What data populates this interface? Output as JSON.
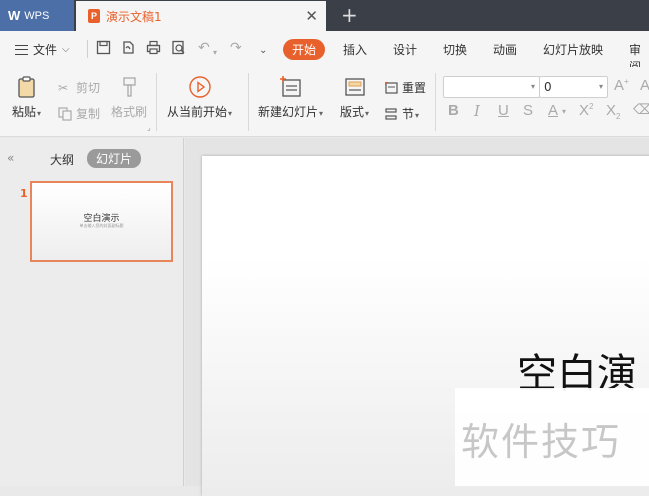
{
  "titlebar": {
    "app_name": "WPS",
    "document_tab": "演示文稿1",
    "close_glyph": "✕",
    "new_tab_glyph": "+"
  },
  "menu": {
    "file_label": "文件",
    "tabs": [
      "开始",
      "插入",
      "设计",
      "切换",
      "动画",
      "幻灯片放映",
      "审阅"
    ],
    "active_tab": "开始"
  },
  "ribbon": {
    "paste": "粘贴",
    "cut": "剪切",
    "copy": "复制",
    "format_painter": "格式刷",
    "from_current": "从当前开始",
    "new_slide": "新建幻灯片",
    "layout": "版式",
    "reset": "重置",
    "section": "节",
    "font_size_value": "0",
    "font_name_value": ""
  },
  "left_panel": {
    "outline_tab": "大纲",
    "slides_tab": "幻灯片",
    "slide_number": "1",
    "thumb_title": "空白演示",
    "thumb_subtitle": "单击输入您的封面副标题"
  },
  "slide": {
    "title": "空白演"
  },
  "watermark": "软件技巧",
  "colors": {
    "accent": "#e8612c",
    "titlebar": "#3b3f48",
    "wps_tab": "#4c6fa8"
  }
}
